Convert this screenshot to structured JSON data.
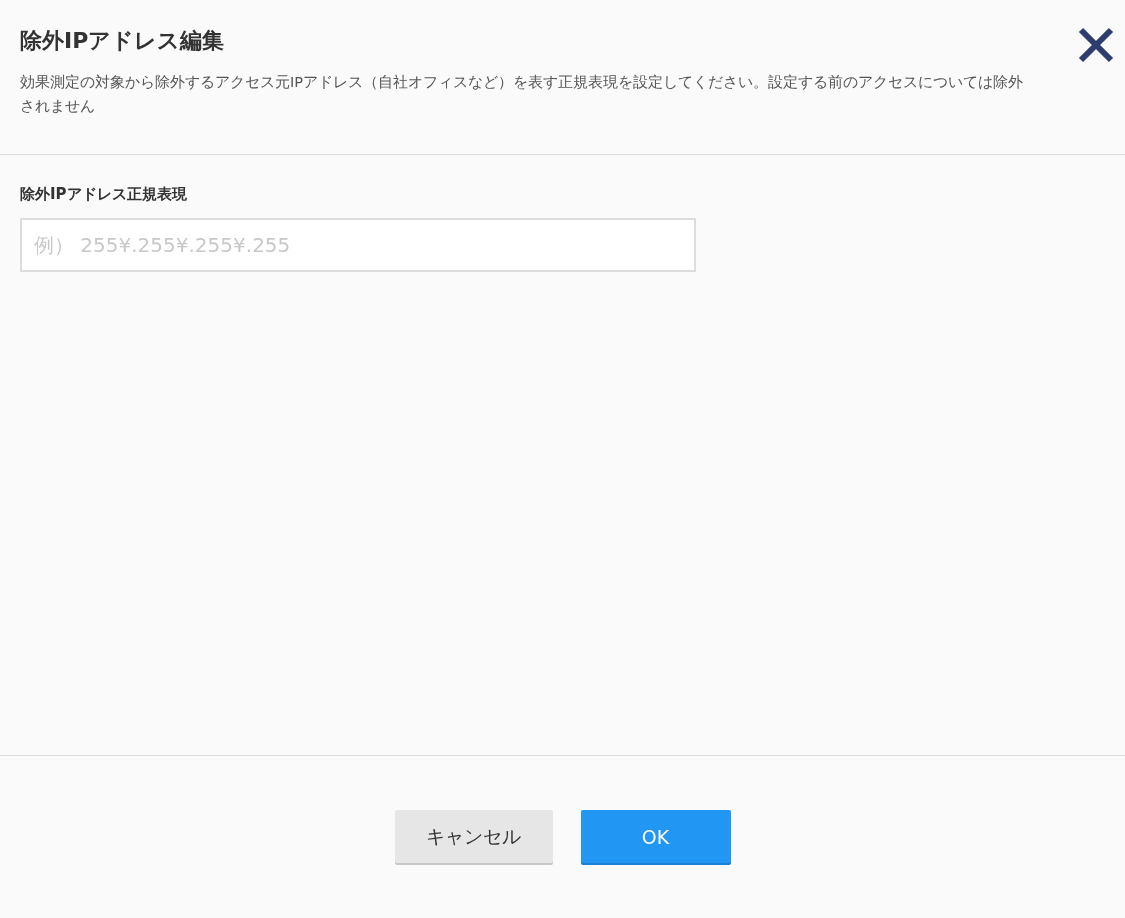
{
  "dialog": {
    "title": "除外IPアドレス編集",
    "description": "効果測定の対象から除外するアクセス元IPアドレス（自社オフィスなど）を表す正規表現を設定してください。設定する前のアクセスについては除外されません"
  },
  "field": {
    "label": "除外IPアドレス正規表現",
    "placeholder": "例） 255¥.255¥.255¥.255"
  },
  "buttons": [
    {
      "label": "キャンセル",
      "kind": "secondary"
    },
    {
      "label": "OK",
      "kind": "primary"
    }
  ]
}
